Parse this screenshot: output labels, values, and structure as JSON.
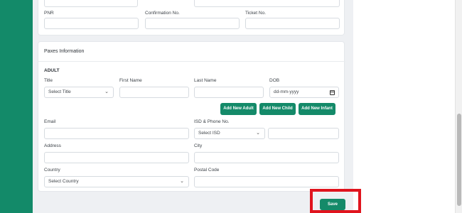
{
  "top_form": {
    "pnr_label": "PNR",
    "confirmation_label": "Confirmation No.",
    "ticket_label": "Ticket No.",
    "pnr_value": "",
    "confirmation_value": "",
    "ticket_value": ""
  },
  "paxes": {
    "title": "Paxes Information",
    "adult_heading": "ADULT",
    "title_label": "Title",
    "title_select": "Select Title",
    "first_name_label": "First Name",
    "last_name_label": "Last Name",
    "dob_label": "DOB",
    "dob_placeholder": "dd-mm-yyyy",
    "add_adult": "Add New Adult",
    "add_child": "Add New Child",
    "add_infant": "Add New Infant",
    "email_label": "Email",
    "phone_label": "ISD & Phone No.",
    "isd_select": "Select ISD",
    "address_label": "Address",
    "city_label": "City",
    "country_label": "Country",
    "country_select": "Select Country",
    "postal_label": "Postal Code"
  },
  "footer": {
    "save_label": "Save"
  },
  "colors": {
    "brand": "#138a69",
    "highlight": "#e0141e"
  }
}
